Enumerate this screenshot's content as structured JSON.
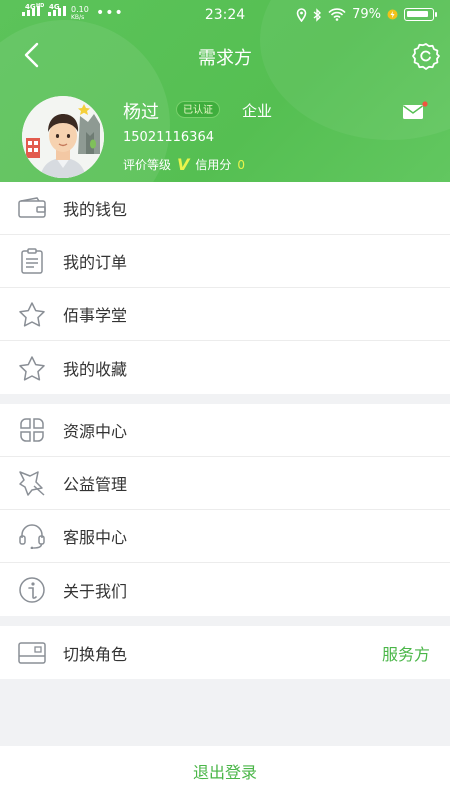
{
  "status": {
    "network_left": "4G",
    "network_hd": "HD",
    "network_right": "4G",
    "speed_value": "0.10",
    "speed_unit": "KB/s",
    "dots": "•••",
    "time": "23:24",
    "battery": "79%"
  },
  "nav": {
    "title": "需求方"
  },
  "profile": {
    "name": "杨过",
    "verified": "已认证",
    "type": "企业",
    "phone": "15021116364",
    "rating_label": "评价等级",
    "rating_value": "V",
    "credit_label": "信用分",
    "credit_value": "0"
  },
  "menu_group1": [
    {
      "label": "我的钱包",
      "icon": "wallet-icon"
    },
    {
      "label": "我的订单",
      "icon": "clipboard-icon"
    },
    {
      "label": "佰事学堂",
      "icon": "star-icon"
    },
    {
      "label": "我的收藏",
      "icon": "star-icon"
    }
  ],
  "menu_group2": [
    {
      "label": "资源中心",
      "icon": "grid-icon"
    },
    {
      "label": "公益管理",
      "icon": "leaf-icon"
    },
    {
      "label": "客服中心",
      "icon": "headset-icon"
    },
    {
      "label": "关于我们",
      "icon": "info-icon"
    }
  ],
  "switch_role": {
    "label": "切换角色",
    "value": "服务方",
    "icon": "id-card-icon"
  },
  "logout": {
    "label": "退出登录"
  },
  "colors": {
    "primary": "#55bf52",
    "accent_text": "#4ab648",
    "background": "#f1f2f4"
  }
}
